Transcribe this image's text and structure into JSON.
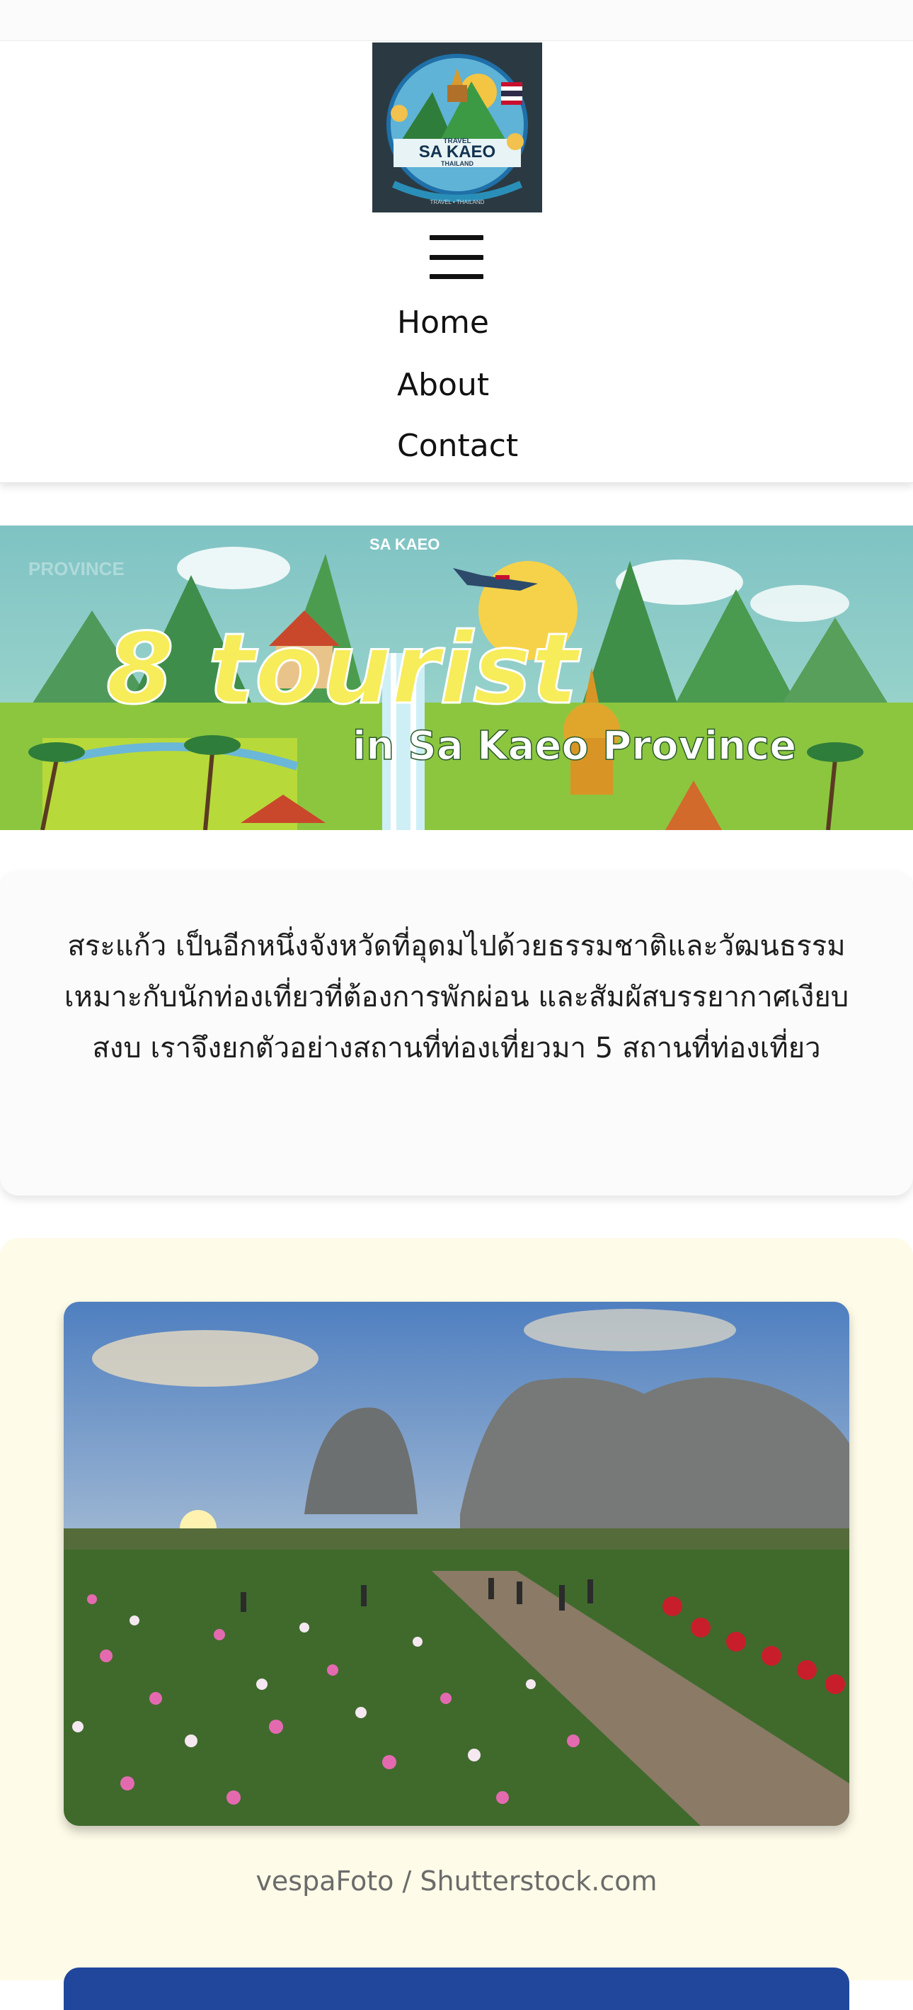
{
  "header": {
    "logo": {
      "top_text": "TRAVEL",
      "name": "SA KAEO",
      "sub_text": "THAILAND",
      "bottom_text": "TRAVEL • THAILAND"
    },
    "menu_icon": "hamburger-menu-icon",
    "nav": [
      {
        "label": "Home"
      },
      {
        "label": "About"
      },
      {
        "label": "Contact"
      }
    ]
  },
  "banner": {
    "small_label": "SA KAEO",
    "faded_label": "PROVINCE",
    "title": "8 tourist",
    "subtitle": "in Sa Kaeo Province"
  },
  "intro": {
    "text": "สระแก้ว เป็นอีกหนึ่งจังหวัดที่อุดมไปด้วยธรรมชาติและวัฒนธรรม เหมาะกับนักท่องเที่ยวที่ต้องการพักผ่อน และสัมผัสบรรยากาศเงียบสงบ เราจึงยกตัวอย่างสถานที่ท่องเที่ยวมา 5 สถานที่ท่องเที่ยว"
  },
  "places": [
    {
      "caption": "vespaFoto / Shutterstock.com"
    }
  ],
  "colors": {
    "banner_title": "#f7ec5a",
    "place_section_bg": "#fefbe8",
    "logo_bg": "#2b3a42"
  }
}
